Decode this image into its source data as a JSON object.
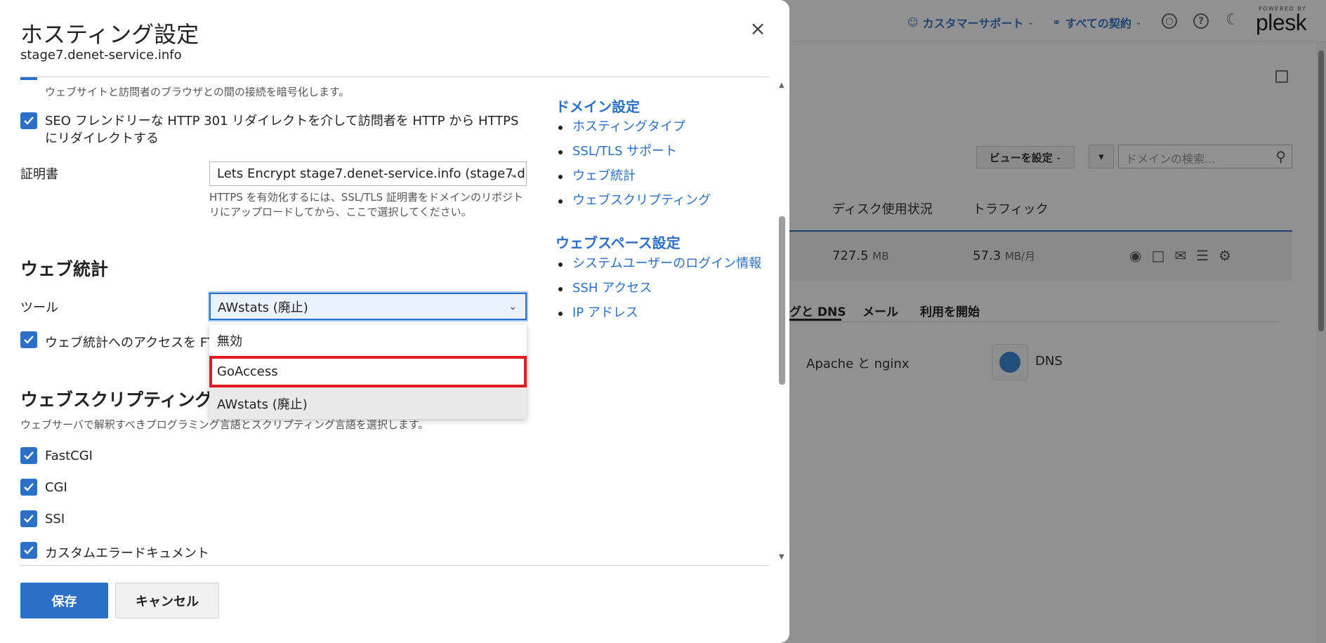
{
  "background": {
    "customer_support": "カスタマーサポート",
    "all_subscriptions": "すべての契約",
    "powered_by": "POWERED BY",
    "plesk": "plesk",
    "view_button": "ビューを設定",
    "search_placeholder": "ドメインの検索...",
    "col_disk": "ディスク使用状況",
    "col_traffic": "トラフィック",
    "disk_value": "727.5",
    "disk_unit": "MB",
    "traffic_value": "57.3",
    "traffic_unit": "MB/月",
    "tab_dns": "グと DNS",
    "tab_mail": "メール",
    "tab_start": "利用を開始",
    "svc_apache": "Apache と nginx",
    "svc_dns": "DNS"
  },
  "modal": {
    "title": "ホスティング設定",
    "subtitle": "stage7.denet-service.info",
    "ssl_desc": "ウェブサイトと訪問者のブラウザとの間の接続を暗号化します。",
    "seo_redirect": "SEO フレンドリーな HTTP 301 リダイレクトを介して訪問者を HTTP から HTTPS にリダイレクトする",
    "cert_label": "証明書",
    "cert_value": "Lets Encrypt stage7.denet-service.info (stage7.d...",
    "cert_help": "HTTPS を有効化するには、SSL/TLS 証明書をドメインのリポジトリにアップロードしてから、ここで選択してください。",
    "webstats_heading": "ウェブ統計",
    "tool_label": "ツール",
    "tool_value": "AWstats (廃止)",
    "tool_options": [
      "無効",
      "GoAccess",
      "AWstats (廃止)"
    ],
    "webstats_access": "ウェブ統計へのアクセスを FTI",
    "scripting_heading": "ウェブスクリプティング",
    "scripting_desc": "ウェブサーバで解釈すべきプログラミング言語とスクリプティング言語を選択します。",
    "opt_fastcgi": "FastCGI",
    "opt_cgi": "CGI",
    "opt_ssi": "SSI",
    "opt_custom_error": "カスタムエラードキュメント",
    "save": "保存",
    "cancel": "キャンセル"
  },
  "sidebar": {
    "domain_heading": "ドメイン設定",
    "domain_links": [
      "ホスティングタイプ",
      "SSL/TLS サポート",
      "ウェブ統計",
      "ウェブスクリプティング"
    ],
    "webspace_heading": "ウェブスペース設定",
    "webspace_links": [
      "システムユーザーのログイン情報",
      "SSH アクセス",
      "IP アドレス"
    ]
  },
  "colors": {
    "accent": "#2c6fc6",
    "highlight": "#e01b24"
  }
}
